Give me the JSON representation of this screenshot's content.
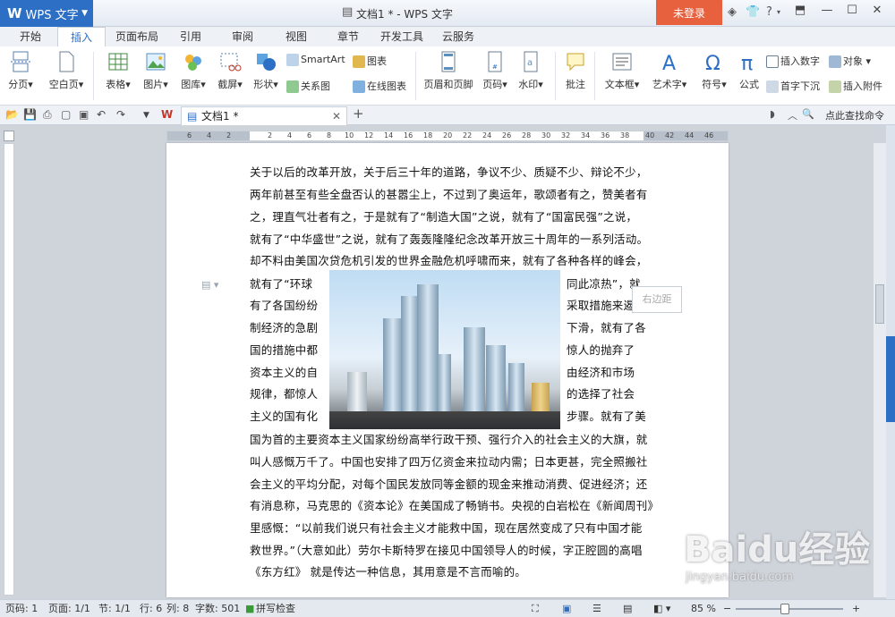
{
  "app": {
    "name": "WPS 文字",
    "window_title": "文档1 * - WPS 文字",
    "login": "未登录"
  },
  "menu_tabs": [
    "开始",
    "插入",
    "页面布局",
    "引用",
    "审阅",
    "视图",
    "章节",
    "开发工具",
    "云服务"
  ],
  "active_tab": "插入",
  "ribbon": {
    "big": [
      "分页",
      "空白页",
      "表格",
      "图片",
      "图库",
      "截屏",
      "形状",
      "页眉和页脚",
      "页码",
      "水印",
      "批注",
      "文本框",
      "艺术字",
      "符号",
      "公式"
    ],
    "small": {
      "smartart": "SmartArt",
      "chart": "图表",
      "relation": "关系图",
      "online_chart": "在线图表",
      "insert_number": "插入数字",
      "object": "对象",
      "drop_cap": "首字下沉",
      "insert_attachment": "插入附件"
    }
  },
  "doc_tab": "文档1 *",
  "find_command": "点此查找命令",
  "ruler": {
    "numbers": [
      "6",
      "4",
      "2",
      "2",
      "4",
      "6",
      "8",
      "10",
      "12",
      "14",
      "16",
      "18",
      "20",
      "22",
      "24",
      "26",
      "28",
      "30",
      "32",
      "34",
      "36",
      "38",
      "40",
      "42",
      "44",
      "46"
    ]
  },
  "document": {
    "lines": [
      "关于以后的改革开放，关于后三十年的道路，争议不少、质疑不少、辩论不少，",
      "两年前甚至有些全盘否认的甚嚣尘上，不过到了奥运年，歌颂者有之，赞美者有",
      "之，理直气壮者有之，于是就有了“制造大国”之说，就有了“国富民强”之说，",
      "就有了“中华盛世”之说，就有了轰轰隆隆纪念改革开放三十周年的一系列活动。",
      "却不料由美国次贷危机引发的世界金融危机呼啸而来，就有了各种各样的峰会，"
    ],
    "left_wrap": [
      "就有了“环球",
      "有了各国纷纷",
      "制经济的急剧",
      "国的措施中都",
      "资本主义的自",
      "规律，都惊人",
      "主义的国有化"
    ],
    "right_wrap": [
      "同此凉热”，就",
      "采取措施来遏",
      "下滑，就有了各",
      "惊人的抛弃了",
      "由经济和市场",
      "的选择了社会",
      "步骤。就有了美"
    ],
    "tail": [
      "国为首的主要资本主义国家纷纷高举行政干预、强行介入的社会主义的大旗，就",
      "叫人感慨万千了。中国也安排了四万亿资金来拉动内需；日本更甚，完全照搬社",
      "会主义的平均分配，对每个国民发放同等金额的现金来推动消费、促进经济；还",
      "有消息称，马克思的《资本论》在美国成了畅销书。央视的白岩松在《新闻周刊》",
      "里感慨：“以前我们说只有社会主义才能救中国，现在居然变成了只有中国才能",
      "救世界。”（大意如此）劳尔卡斯特罗在接见中国领导人的时候，字正腔圆的高唱",
      "《东方红》 就是传达一种信息，其用意是不言而喻的。"
    ],
    "margin_tip": "右边距"
  },
  "status": {
    "page": "页码: 1",
    "pages": "页面: 1/1",
    "section": "节: 1/1",
    "row": "行: 6",
    "col": "列: 8",
    "words": "字数: 501",
    "spell": "拼写检查",
    "zoom": "85 %"
  },
  "watermark": {
    "brand": "Baidu经验",
    "url": "jingyan.baidu.com"
  }
}
